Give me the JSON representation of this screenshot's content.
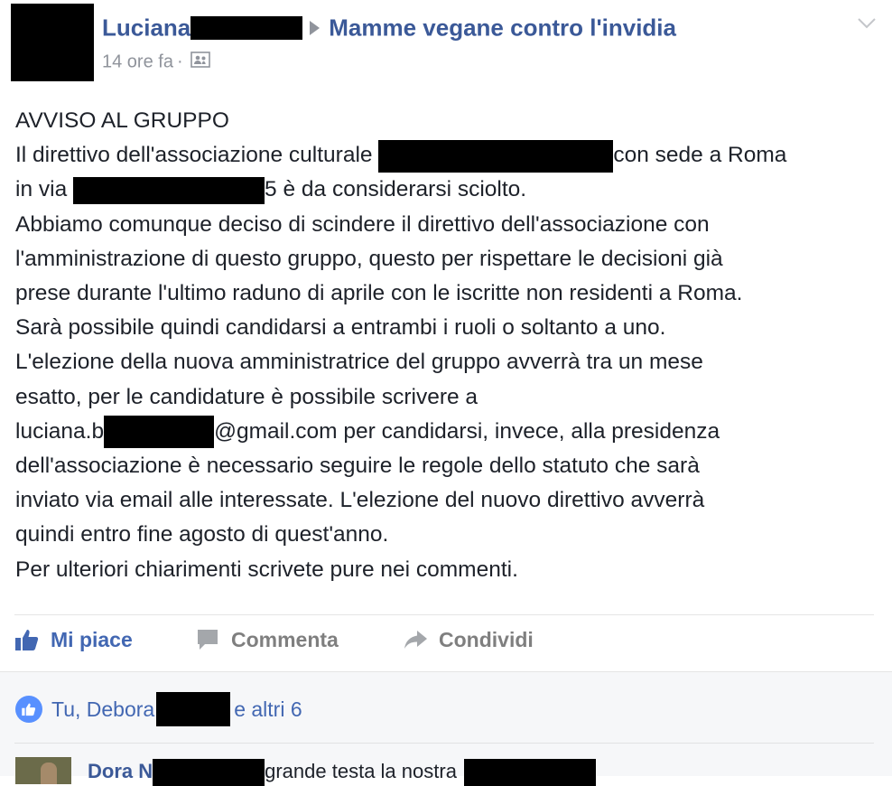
{
  "post": {
    "author_name": "Luciana",
    "group_name": "Mamme vegane contro l'invidia",
    "timestamp": "14 ore fa",
    "separator": "·",
    "privacy_icon": "friends-icon",
    "options_icon": "chevron-down-icon",
    "body": {
      "l1": "AVVISO AL GRUPPO",
      "l2a": "Il direttivo dell'associazione culturale ",
      "l2b": "con sede a Roma",
      "l3a": "in via ",
      "l3b": "5 è da considerarsi sciolto.",
      "l4": "Abbiamo comunque deciso di scindere il direttivo dell'associazione con",
      "l5": "l'amministrazione di questo gruppo, questo per rispettare le decisioni già",
      "l6": "prese durante l'ultimo raduno di aprile con le iscritte non residenti a Roma.",
      "l7": "Sarà possibile quindi candidarsi a entrambi i ruoli o soltanto a uno.",
      "l8": "L'elezione della nuova amministratrice del gruppo avverrà tra un mese",
      "l9": "esatto, per le candidature è possibile scrivere a",
      "l10a": "luciana.b",
      "l10b": "@gmail.com per candidarsi, invece, alla presidenza",
      "l11": "dell'associazione è necessario seguire le regole dello statuto che sarà",
      "l12": "inviato via email alle interessate. L'elezione del nuovo direttivo avverrà",
      "l13": "quindi entro fine agosto di quest'anno.",
      "l14": "Per ulteriori chiarimenti scrivete pure nei commenti."
    }
  },
  "actions": {
    "like_label": "Mi piace",
    "comment_label": "Commenta",
    "share_label": "Condividi"
  },
  "reactions": {
    "prefix": "Tu, Debora",
    "suffix": "e altri 6"
  },
  "comment": {
    "author_name": "Dora N",
    "text": "grande testa la nostra"
  },
  "colors": {
    "link_blue": "#3b5998",
    "like_blue": "#4267b2",
    "badge_blue": "#5890ff",
    "muted_gray": "#90949c",
    "body_text": "#1d2129",
    "footer_bg": "#f6f7f9"
  }
}
